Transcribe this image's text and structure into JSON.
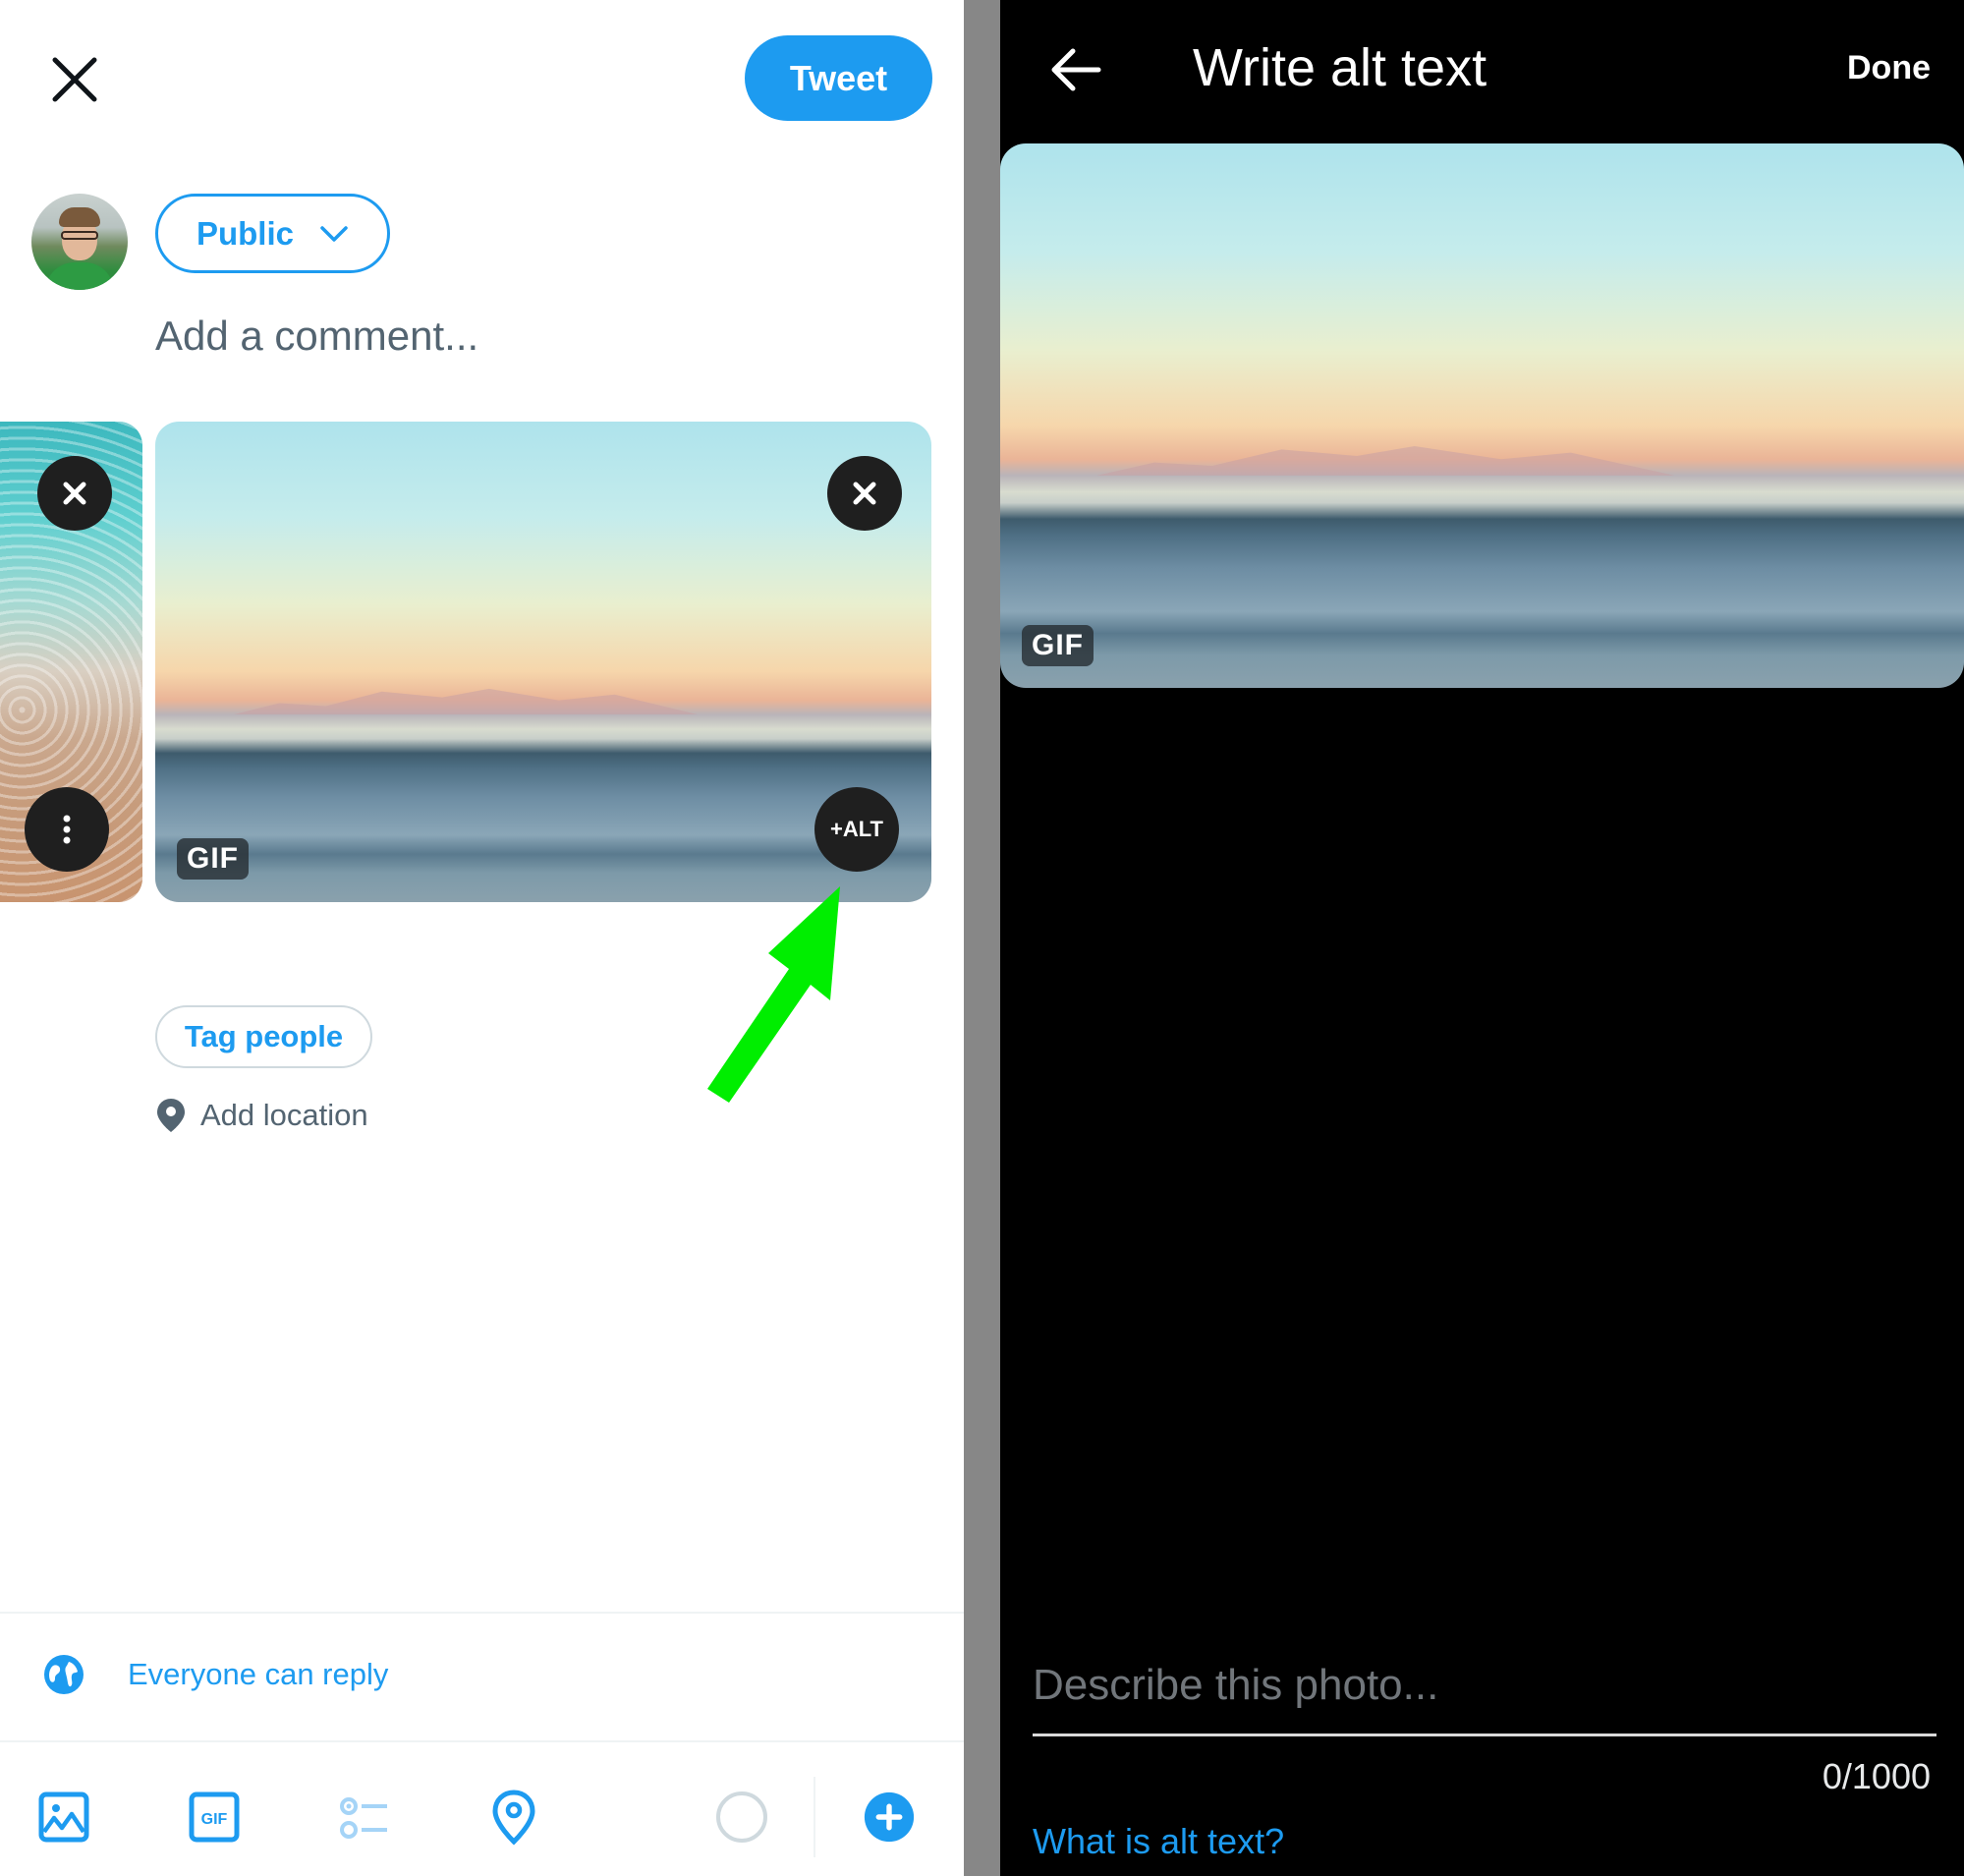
{
  "compose": {
    "tweet_label": "Tweet",
    "audience_label": "Public",
    "comment_placeholder": "Add a comment...",
    "media": {
      "gif_badge": "GIF",
      "alt_button": "+ALT"
    },
    "tag_people_label": "Tag people",
    "add_location_label": "Add location",
    "reply_setting_label": "Everyone can reply",
    "toolbar": {
      "icons": [
        "image-icon",
        "gif-icon",
        "poll-icon",
        "location-icon",
        "character-count-ring-icon",
        "add-thread-icon"
      ]
    },
    "colors": {
      "accent": "#1d9bf0",
      "annotation_arrow": "#00ee00"
    }
  },
  "alt_text_editor": {
    "title": "Write alt text",
    "done_label": "Done",
    "gif_badge": "GIF",
    "input_placeholder": "Describe this photo...",
    "char_count": "0/1000",
    "help_link": "What is alt text?"
  }
}
